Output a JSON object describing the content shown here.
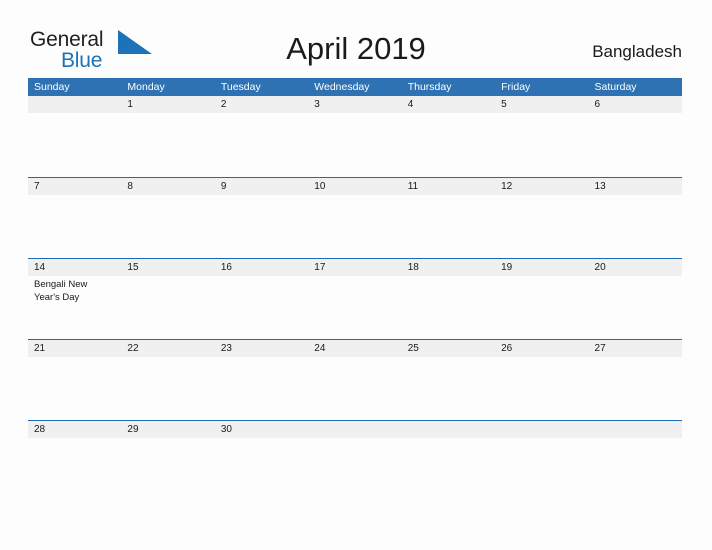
{
  "brand": {
    "line1": "General",
    "line2": "Blue",
    "flag_icon": "blue-triangle-flag-icon",
    "line1_color": "#231F20",
    "line2_color": "#1E72B8",
    "flag_color": "#1E72B8"
  },
  "header": {
    "title": "April 2019",
    "region": "Bangladesh"
  },
  "theme": {
    "header_blue": "#2E72B3",
    "row_divider_blue": "#1F6AB0",
    "date_band_gray": "#F0F0F0",
    "page_background": "#FDFDFD",
    "text_color": "#1A1A1A",
    "weekday_text": "#FFFFFF"
  },
  "calendar": {
    "month": "April",
    "year": "2019",
    "weekday_headers": [
      "Sunday",
      "Monday",
      "Tuesday",
      "Wednesday",
      "Thursday",
      "Friday",
      "Saturday"
    ],
    "weeks": [
      {
        "days": [
          {
            "date": "",
            "event": ""
          },
          {
            "date": "1",
            "event": ""
          },
          {
            "date": "2",
            "event": ""
          },
          {
            "date": "3",
            "event": ""
          },
          {
            "date": "4",
            "event": ""
          },
          {
            "date": "5",
            "event": ""
          },
          {
            "date": "6",
            "event": ""
          }
        ]
      },
      {
        "days": [
          {
            "date": "7",
            "event": ""
          },
          {
            "date": "8",
            "event": ""
          },
          {
            "date": "9",
            "event": ""
          },
          {
            "date": "10",
            "event": ""
          },
          {
            "date": "11",
            "event": ""
          },
          {
            "date": "12",
            "event": ""
          },
          {
            "date": "13",
            "event": ""
          }
        ]
      },
      {
        "days": [
          {
            "date": "14",
            "event": "Bengali New Year's Day"
          },
          {
            "date": "15",
            "event": ""
          },
          {
            "date": "16",
            "event": ""
          },
          {
            "date": "17",
            "event": ""
          },
          {
            "date": "18",
            "event": ""
          },
          {
            "date": "19",
            "event": ""
          },
          {
            "date": "20",
            "event": ""
          }
        ]
      },
      {
        "days": [
          {
            "date": "21",
            "event": ""
          },
          {
            "date": "22",
            "event": ""
          },
          {
            "date": "23",
            "event": ""
          },
          {
            "date": "24",
            "event": ""
          },
          {
            "date": "25",
            "event": ""
          },
          {
            "date": "26",
            "event": ""
          },
          {
            "date": "27",
            "event": ""
          }
        ]
      },
      {
        "days": [
          {
            "date": "28",
            "event": ""
          },
          {
            "date": "29",
            "event": ""
          },
          {
            "date": "30",
            "event": ""
          },
          {
            "date": "",
            "event": ""
          },
          {
            "date": "",
            "event": ""
          },
          {
            "date": "",
            "event": ""
          },
          {
            "date": "",
            "event": ""
          }
        ]
      }
    ]
  }
}
